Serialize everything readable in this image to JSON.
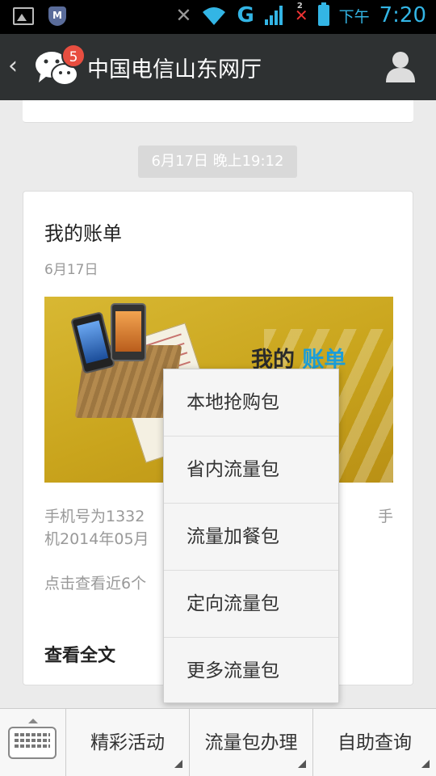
{
  "status_bar": {
    "signal_type": "G",
    "sim_indicator": "2",
    "ampm": "下午",
    "time": "7:20",
    "icons": [
      "image-icon",
      "security-shield-icon",
      "mute-icon",
      "wifi-icon",
      "signal-icon",
      "no-sim-icon",
      "battery-icon"
    ]
  },
  "header": {
    "back_icon": "‹",
    "unread_badge": "5",
    "title": "中国电信山东网厅"
  },
  "chat": {
    "timestamp": "6月17日 晚上19:12",
    "article": {
      "title": "我的账单",
      "date": "6月17日",
      "banner": {
        "text_dark": "我的",
        "text_highlight": "账单"
      },
      "summary_line1": "手机号为1332",
      "summary_line1_tail": "手",
      "summary_line2": "机2014年05月",
      "summary_line3": "点击查看近6个",
      "read_more": "查看全文"
    }
  },
  "popup_menu": {
    "items": [
      "本地抢购包",
      "省内流量包",
      "流量加餐包",
      "定向流量包",
      "更多流量包"
    ]
  },
  "bottom_menu": {
    "items": [
      "精彩活动",
      "流量包办理",
      "自助查询"
    ]
  },
  "colors": {
    "accent": "#33b5e5",
    "titlebar": "#2e3132",
    "badge": "#e84e40",
    "highlight": "#1a9dd8"
  }
}
